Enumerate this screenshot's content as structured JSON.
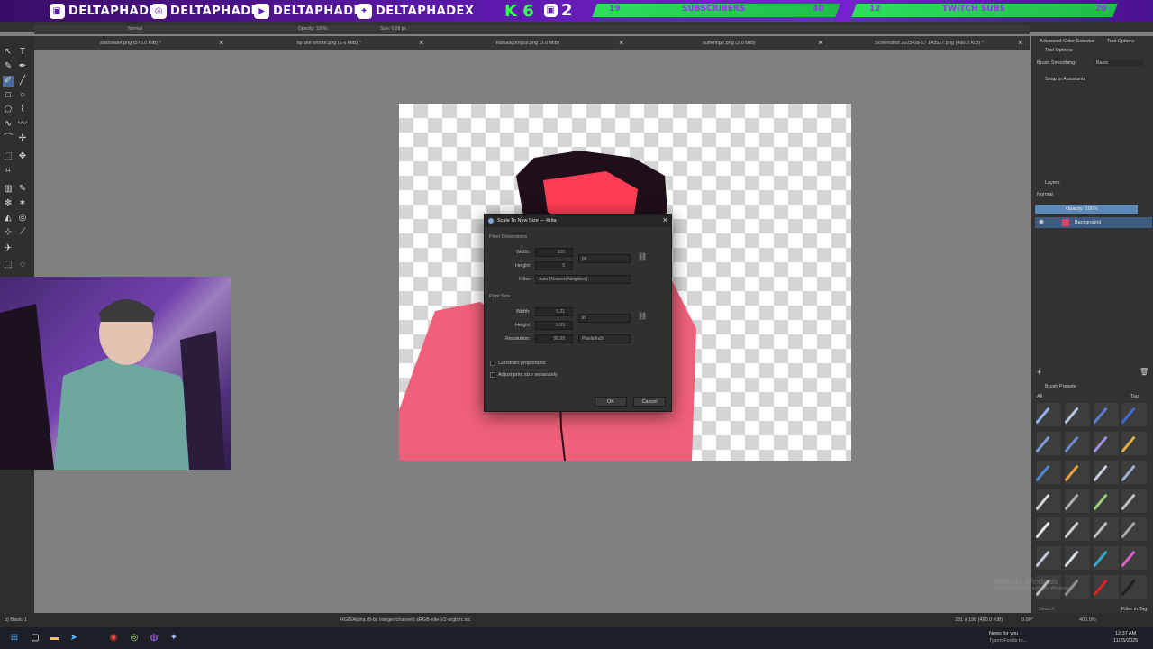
{
  "banner": {
    "handles": [
      "DELTAPHADE",
      "DELTAPHADE",
      "DELTAPHADE",
      "DELTAPHADEX"
    ],
    "k6": "K 6",
    "goal1": {
      "current": "19",
      "label": "SUBSCRIBERS",
      "target": "40"
    },
    "goal2": {
      "current": "12",
      "label": "TWITCH SUBS",
      "target": "20"
    },
    "number": "2"
  },
  "tabs": [
    {
      "label": "suslowdef.png (576.0 KiB) *"
    },
    {
      "label": "lip bite emote.png (2.6 MiB) *"
    },
    {
      "label": "kamalajomgus.png (2.0 MiB)"
    },
    {
      "label": "suffering2.png (2.0 MiB)"
    },
    {
      "label": "Screenshot 2025-08-17 143527.png (480.0 KiB) *"
    }
  ],
  "toolstrip": {
    "blend": "Normal",
    "opacity": "Opacity: 100%",
    "size": "Size: 0.08 px"
  },
  "right_panel": {
    "tabs": [
      "Advanced Color Selector",
      "Tool Options"
    ],
    "tool_options_title": "Tool Options",
    "brush_smoothing_label": "Brush Smoothing:",
    "brush_smoothing_value": "Basic",
    "snap_label": "Snap to Assistants",
    "layers_title": "Layers",
    "layers_blend": "Normal",
    "layers_opacity": "Opacity: 100%",
    "layer_name": "Background",
    "brush_presets_title": "Brush Presets",
    "brush_presets_filter": "All",
    "brush_presets_tag": "Tag",
    "filter_in_tag": "Filter in Tag",
    "search_placeholder": "Search"
  },
  "dialog": {
    "title": "Scale To New Size — Krita",
    "pixel_dimensions": "Pixel Dimensions",
    "width_label": "Width:",
    "width_value": "500",
    "height_label": "Height:",
    "height_value": "5",
    "unit_px": "px",
    "filter_label": "Filter:",
    "filter_value": "Auto (Nearest Neighbor)",
    "print_size": "Print Size",
    "print_width_label": "Width:",
    "print_width_value": "5.21",
    "print_height_label": "Height:",
    "print_height_value": "0.05",
    "unit_in": "in",
    "resolution_label": "Resolution:",
    "resolution_value": "95.99",
    "resolution_unit": "Pixels/Inch",
    "constrain": "Constrain proportions",
    "adjust": "Adjust print size separately",
    "ok": "OK",
    "cancel": "Cancel"
  },
  "statusbar": {
    "left": "b) Basic-1",
    "color": "RGB/Alpha (8-bit integer/channel)  sRGB-elle-V2-srgbtrc.icc",
    "dims": "231 x 198 (480.0 KiB)",
    "rotation": "0.00°",
    "zoom": "400.0%"
  },
  "taskbar": {
    "news": "News for you",
    "news_sub": "Tyson Foods to...",
    "time": "12:37 AM",
    "date": "11/25/2025"
  },
  "watermark": {
    "line1": "Activate Windows",
    "line2": "Go to Settings to activate Windows."
  }
}
